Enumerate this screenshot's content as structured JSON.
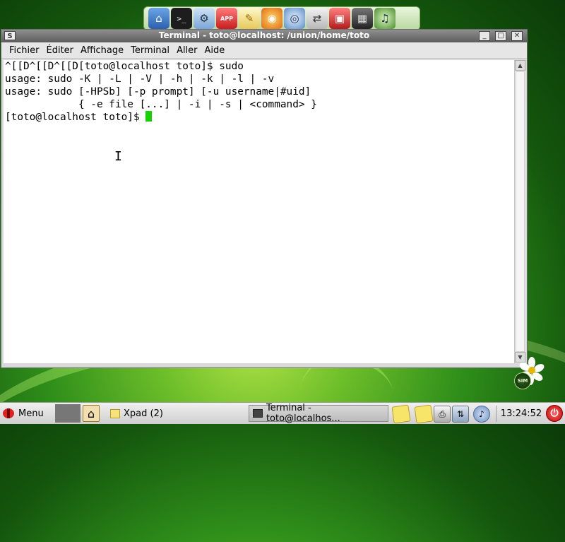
{
  "dock": {
    "icons": [
      "home-folder-icon",
      "terminal-icon",
      "system-tools-icon",
      "app-store-icon",
      "text-editor-icon",
      "firefox-icon",
      "disc-burner-icon",
      "network-icon",
      "toolbox-icon",
      "video-player-icon",
      "headphones-icon"
    ],
    "labels": {
      "app": "APP",
      "term": ">_"
    }
  },
  "window": {
    "title": "Terminal - toto@localhost: /union/home/toto",
    "menu": [
      "Fichier",
      "Éditer",
      "Affichage",
      "Terminal",
      "Aller",
      "Aide"
    ],
    "terminal_lines": [
      "^[[D^[[D^[[D[toto@localhost toto]$ sudo",
      "usage: sudo -K | -L | -V | -h | -k | -l | -v",
      "usage: sudo [-HPSb] [-p prompt] [-u username|#uid]",
      "            { -e file [...] | -i | -s | <command> }",
      "[toto@localhost toto]$ "
    ]
  },
  "taskbar": {
    "menu_label": "Menu",
    "xpad_label": "Xpad (2)",
    "terminal_task_label": "Terminal - toto@localhos...",
    "clock": "13:24:52"
  },
  "badge": "SIM"
}
